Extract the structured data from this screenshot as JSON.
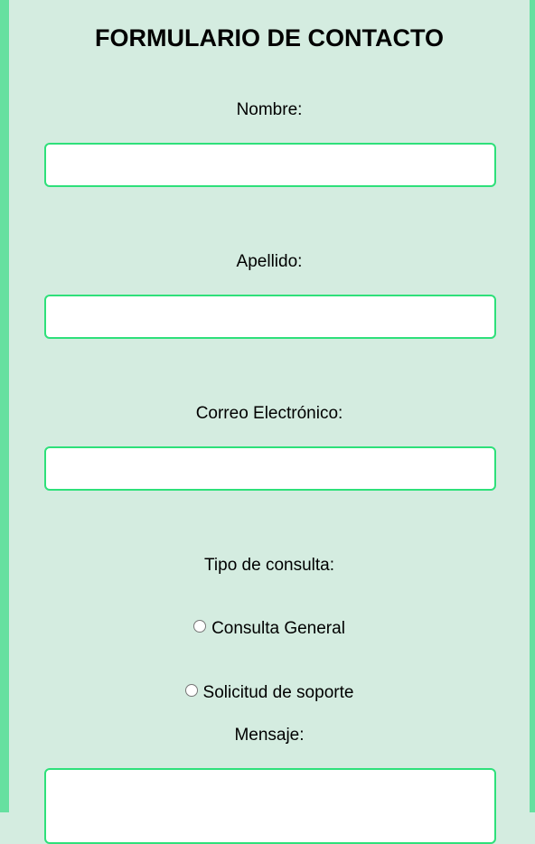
{
  "form": {
    "title": "FORMULARIO DE CONTACTO",
    "nombre_label": "Nombre:",
    "nombre_value": "",
    "apellido_label": "Apellido:",
    "apellido_value": "",
    "correo_label": "Correo Electrónico:",
    "correo_value": "",
    "tipo_label": "Tipo de consulta:",
    "radio_options": [
      {
        "label": "Consulta General",
        "checked": false
      },
      {
        "label": "Solicitud de soporte",
        "checked": false
      }
    ],
    "mensaje_label": "Mensaje:",
    "mensaje_value": ""
  },
  "colors": {
    "background": "#d4ece0",
    "stripe": "#66e0a0",
    "input_border": "#2ee07a"
  }
}
